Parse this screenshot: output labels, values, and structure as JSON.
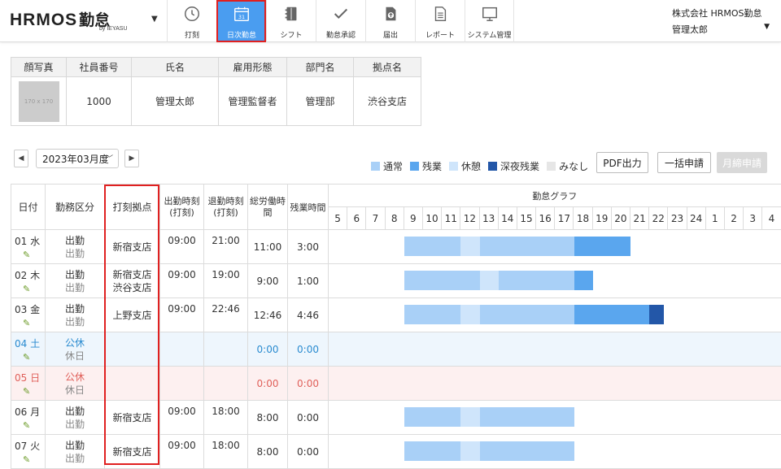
{
  "app": {
    "brand": "HRMOS",
    "brand_suffix": "勤怠",
    "by": "by IEYASU",
    "company": "株式会社 HRMOS勤怠",
    "user": "管理太郎"
  },
  "nav": [
    {
      "label": "打刻",
      "icon": "clock-icon"
    },
    {
      "label": "日次勤怠",
      "icon": "calendar-icon",
      "active": true
    },
    {
      "label": "シフト",
      "icon": "notebook-icon"
    },
    {
      "label": "勤怠承認",
      "icon": "check-icon"
    },
    {
      "label": "届出",
      "icon": "upload-doc-icon"
    },
    {
      "label": "レポート",
      "icon": "report-icon"
    },
    {
      "label": "システム管理",
      "icon": "monitor-icon"
    }
  ],
  "calendar_icon_day": "31",
  "employee": {
    "headers": [
      "顔写真",
      "社員番号",
      "氏名",
      "雇用形態",
      "部門名",
      "拠点名"
    ],
    "photo_placeholder": "170 x 170",
    "number": "1000",
    "name": "管理太郎",
    "employment": "管理監督者",
    "department": "管理部",
    "location": "渋谷支店"
  },
  "month": {
    "selected": "2023年03月度"
  },
  "legend": [
    {
      "label": "通常",
      "color": "#a9d0f7"
    },
    {
      "label": "残業",
      "color": "#5aa6ee"
    },
    {
      "label": "休憩",
      "color": "#cfe5fb"
    },
    {
      "label": "深夜残業",
      "color": "#2357a8"
    },
    {
      "label": "みなし",
      "color": "#e6e6e6"
    }
  ],
  "buttons": {
    "pdf": "PDF出力",
    "bulk": "一括申請",
    "monthly": "月締申請"
  },
  "table": {
    "headers": {
      "date": "日付",
      "kubun": "勤務区分",
      "location": "打刻拠点",
      "clock_in": "出勤時刻(打刻)",
      "clock_out": "退勤時刻(打刻)",
      "total": "総労働時間",
      "overtime": "残業時間",
      "graph": "勤怠グラフ"
    },
    "hours": [
      "5",
      "6",
      "7",
      "8",
      "9",
      "10",
      "11",
      "12",
      "13",
      "14",
      "15",
      "16",
      "17",
      "18",
      "19",
      "20",
      "21",
      "22",
      "23",
      "24",
      "1",
      "2",
      "3",
      "4"
    ],
    "rows": [
      {
        "date": "01 水",
        "type": "weekday",
        "k1": "出勤",
        "k2": "出勤",
        "loc": [
          "新宿支店"
        ],
        "in": "09:00",
        "out": "21:00",
        "total": "11:00",
        "ot": "3:00",
        "bars": [
          {
            "s": 9,
            "e": 12,
            "c": "normal"
          },
          {
            "s": 12,
            "e": 13,
            "c": "break"
          },
          {
            "s": 13,
            "e": 18,
            "c": "normal"
          },
          {
            "s": 18,
            "e": 21,
            "c": "overtime"
          }
        ]
      },
      {
        "date": "02 木",
        "type": "weekday",
        "k1": "出勤",
        "k2": "出勤",
        "loc": [
          "新宿支店",
          "渋谷支店"
        ],
        "in": "09:00",
        "out": "19:00",
        "total": "9:00",
        "ot": "1:00",
        "bars": [
          {
            "s": 9,
            "e": 13,
            "c": "normal"
          },
          {
            "s": 13,
            "e": 14,
            "c": "break"
          },
          {
            "s": 14,
            "e": 18,
            "c": "normal"
          },
          {
            "s": 18,
            "e": 19,
            "c": "overtime"
          }
        ]
      },
      {
        "date": "03 金",
        "type": "weekday",
        "k1": "出勤",
        "k2": "出勤",
        "loc": [
          "上野支店"
        ],
        "in": "09:00",
        "out": "22:46",
        "total": "12:46",
        "ot": "4:46",
        "bars": [
          {
            "s": 9,
            "e": 12,
            "c": "normal"
          },
          {
            "s": 12,
            "e": 13,
            "c": "break"
          },
          {
            "s": 13,
            "e": 18,
            "c": "normal"
          },
          {
            "s": 18,
            "e": 22,
            "c": "overtime"
          },
          {
            "s": 22,
            "e": 22.77,
            "c": "night"
          }
        ]
      },
      {
        "date": "04 土",
        "type": "sat",
        "k1": "公休",
        "k2": "休日",
        "loc": [],
        "in": "",
        "out": "",
        "total": "0:00",
        "ot": "0:00",
        "bars": []
      },
      {
        "date": "05 日",
        "type": "sun",
        "k1": "公休",
        "k2": "休日",
        "loc": [],
        "in": "",
        "out": "",
        "total": "0:00",
        "ot": "0:00",
        "bars": []
      },
      {
        "date": "06 月",
        "type": "weekday",
        "k1": "出勤",
        "k2": "出勤",
        "loc": [
          "新宿支店"
        ],
        "in": "09:00",
        "out": "18:00",
        "total": "8:00",
        "ot": "0:00",
        "bars": [
          {
            "s": 9,
            "e": 12,
            "c": "normal"
          },
          {
            "s": 12,
            "e": 13,
            "c": "break"
          },
          {
            "s": 13,
            "e": 18,
            "c": "normal"
          }
        ]
      },
      {
        "date": "07 火",
        "type": "weekday",
        "k1": "出勤",
        "k2": "出勤",
        "loc": [
          "新宿支店"
        ],
        "in": "09:00",
        "out": "18:00",
        "total": "8:00",
        "ot": "0:00",
        "bars": [
          {
            "s": 9,
            "e": 12,
            "c": "normal"
          },
          {
            "s": 12,
            "e": 13,
            "c": "break"
          },
          {
            "s": 13,
            "e": 18,
            "c": "normal"
          }
        ]
      }
    ]
  },
  "bar_colors": {
    "normal": "#a9d0f7",
    "overtime": "#5aa6ee",
    "break": "#cfe5fb",
    "night": "#2357a8"
  }
}
